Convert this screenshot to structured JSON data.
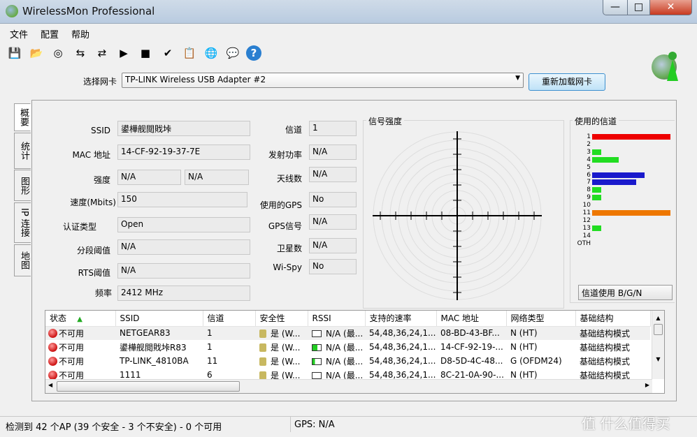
{
  "window": {
    "title": "WirelessMon Professional",
    "minimize": "—",
    "maximize": "□",
    "close": "✕"
  },
  "menu": [
    "文件",
    "配置",
    "帮助"
  ],
  "toolbar": [
    {
      "icon": "save-icon",
      "glyph": "💾"
    },
    {
      "icon": "folder-open-icon",
      "glyph": "📂"
    },
    {
      "icon": "target-icon",
      "glyph": "◎"
    },
    {
      "icon": "network-connect-icon",
      "glyph": "⇆"
    },
    {
      "icon": "network-disconnect-icon",
      "glyph": "⇄"
    },
    {
      "icon": "log-play-icon",
      "glyph": "▶"
    },
    {
      "icon": "log-stop-icon",
      "glyph": "■"
    },
    {
      "icon": "log-check-icon",
      "glyph": "✔"
    },
    {
      "icon": "clipboard-icon",
      "glyph": "📋"
    },
    {
      "icon": "globe-icon",
      "glyph": "🌐"
    },
    {
      "icon": "info-bubble-icon",
      "glyph": "💬"
    },
    {
      "icon": "help-icon",
      "glyph": "?"
    }
  ],
  "adapter": {
    "label": "选择网卡",
    "value": "TP-LINK Wireless USB Adapter #2",
    "reload": "重新加载网卡"
  },
  "tabs": [
    "概要",
    "统计",
    "图形",
    "IP 连接",
    "地图"
  ],
  "summary": {
    "ssid": {
      "label": "SSID",
      "value": "鍙樺舰閲戝垰"
    },
    "mac": {
      "label": "MAC 地址",
      "value": "14-CF-92-19-37-7E"
    },
    "strength": {
      "label": "强度",
      "value1": "N/A",
      "value2": "N/A"
    },
    "speed": {
      "label": "速度(Mbits)",
      "value": "150"
    },
    "auth": {
      "label": "认证类型",
      "value": "Open"
    },
    "frag": {
      "label": "分段阈值",
      "value": "N/A"
    },
    "rts": {
      "label": "RTS阈值",
      "value": "N/A"
    },
    "freq": {
      "label": "频率",
      "value": "2412 MHz"
    },
    "channel": {
      "label": "信道",
      "value": "1"
    },
    "txpower": {
      "label": "发射功率",
      "value": "N/A"
    },
    "antennas": {
      "label": "天线数",
      "value": "N/A"
    },
    "gps_used": {
      "label": "使用的GPS",
      "value": "No"
    },
    "gps_signal": {
      "label": "GPS信号",
      "value": "N/A"
    },
    "satellites": {
      "label": "卫星数",
      "value": "N/A"
    },
    "wispy": {
      "label": "Wi-Spy",
      "value": "No"
    }
  },
  "signal_strength": {
    "title": "信号强度"
  },
  "channels_used": {
    "title": "使用的信道",
    "mode": "信道使用 B/G/N",
    "channels": [
      {
        "label": "1",
        "count": 10,
        "color": "#ee0000"
      },
      {
        "label": "2",
        "count": 0,
        "color": "#22dd22"
      },
      {
        "label": "3",
        "count": 1,
        "color": "#22dd22"
      },
      {
        "label": "4",
        "count": 3,
        "color": "#22dd22"
      },
      {
        "label": "5",
        "count": 0,
        "color": "#22dd22"
      },
      {
        "label": "6",
        "count": 6,
        "color": "#1a1acc"
      },
      {
        "label": "7",
        "count": 5,
        "color": "#1a1acc"
      },
      {
        "label": "8",
        "count": 1,
        "color": "#22dd22"
      },
      {
        "label": "9",
        "count": 1,
        "color": "#22dd22"
      },
      {
        "label": "10",
        "count": 0,
        "color": "#22dd22"
      },
      {
        "label": "11",
        "count": 10,
        "color": "#ee7700"
      },
      {
        "label": "12",
        "count": 0,
        "color": "#22dd22"
      },
      {
        "label": "13",
        "count": 1,
        "color": "#22dd22"
      },
      {
        "label": "14",
        "count": 0,
        "color": "#22dd22"
      },
      {
        "label": "OTH",
        "count": 0,
        "color": "#22dd22"
      }
    ]
  },
  "ap_table": {
    "columns": [
      "状态",
      "SSID",
      "信道",
      "安全性",
      "RSSI",
      "支持的速率",
      "MAC 地址",
      "网络类型",
      "基础结构"
    ],
    "rows": [
      {
        "status": "不可用",
        "ssid": "NETGEAR83",
        "channel": "1",
        "security": "是 (W...",
        "rssi": "N/A (最...",
        "rssi_level": 0,
        "rates": "54,48,36,24,1...",
        "mac": "08-BD-43-BF...",
        "type": "N (HT)",
        "infra": "基础结构模式"
      },
      {
        "status": "不可用",
        "ssid": "鍙樺舰閲戝垰R83",
        "channel": "1",
        "security": "是 (W...",
        "rssi": "N/A (最...",
        "rssi_level": 0.6,
        "rates": "54,48,36,24,1...",
        "mac": "14-CF-92-19-...",
        "type": "N (HT)",
        "infra": "基础结构模式"
      },
      {
        "status": "不可用",
        "ssid": "TP-LINK_4810BA",
        "channel": "11",
        "security": "是 (W...",
        "rssi": "N/A (最...",
        "rssi_level": 0.3,
        "rates": "54,48,36,24,1...",
        "mac": "D8-5D-4C-48...",
        "type": "G (OFDM24)",
        "infra": "基础结构模式"
      },
      {
        "status": "不可用",
        "ssid": "1111",
        "channel": "6",
        "security": "是 (W...",
        "rssi": "N/A (最...",
        "rssi_level": 0,
        "rates": "54,48,36,24,1...",
        "mac": "8C-21-0A-90-...",
        "type": "N (HT)",
        "infra": "基础结构模式"
      }
    ]
  },
  "status_bar": {
    "ap_count": "检测到 42 个AP (39 个安全 - 3 个不安全) - 0 个可用",
    "gps": "GPS: N/A"
  },
  "watermark": "值 什么值得买"
}
